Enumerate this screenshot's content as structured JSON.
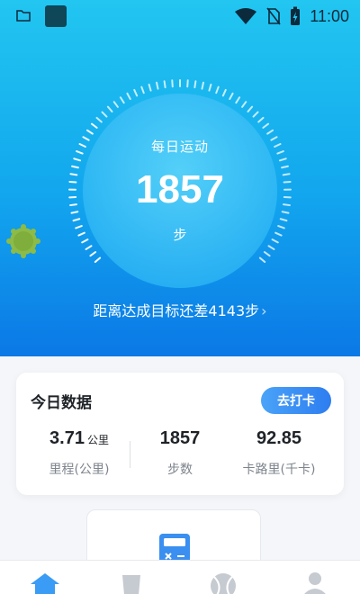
{
  "status_bar": {
    "time": "11:00",
    "icons": [
      "folder-icon",
      "app-square-icon",
      "wifi-icon",
      "no-sim-icon",
      "battery-charging-icon"
    ]
  },
  "hero": {
    "ring_label": "每日运动",
    "steps": "1857",
    "unit": "步",
    "goal_text": "距离达成目标还差4143步",
    "progress_fraction": 0.31,
    "colors": {
      "top": "#22c6f0",
      "bottom": "#0b78e6"
    }
  },
  "today_card": {
    "title": "今日数据",
    "checkin_label": "去打卡",
    "stats": [
      {
        "value": "3.71",
        "unit": "公里",
        "label": "里程(公里)"
      },
      {
        "value": "1857",
        "unit": "",
        "label": "步数"
      },
      {
        "value": "92.85",
        "unit": "",
        "label": "卡路里(千卡)"
      }
    ]
  },
  "tools": {
    "icon": "calculator-icon"
  },
  "tab_bar": {
    "tabs": [
      "home-icon",
      "cup-icon",
      "tennis-ball-icon",
      "profile-icon"
    ],
    "active_color": "#3a9cf5",
    "inactive_color": "#c6cad1"
  }
}
